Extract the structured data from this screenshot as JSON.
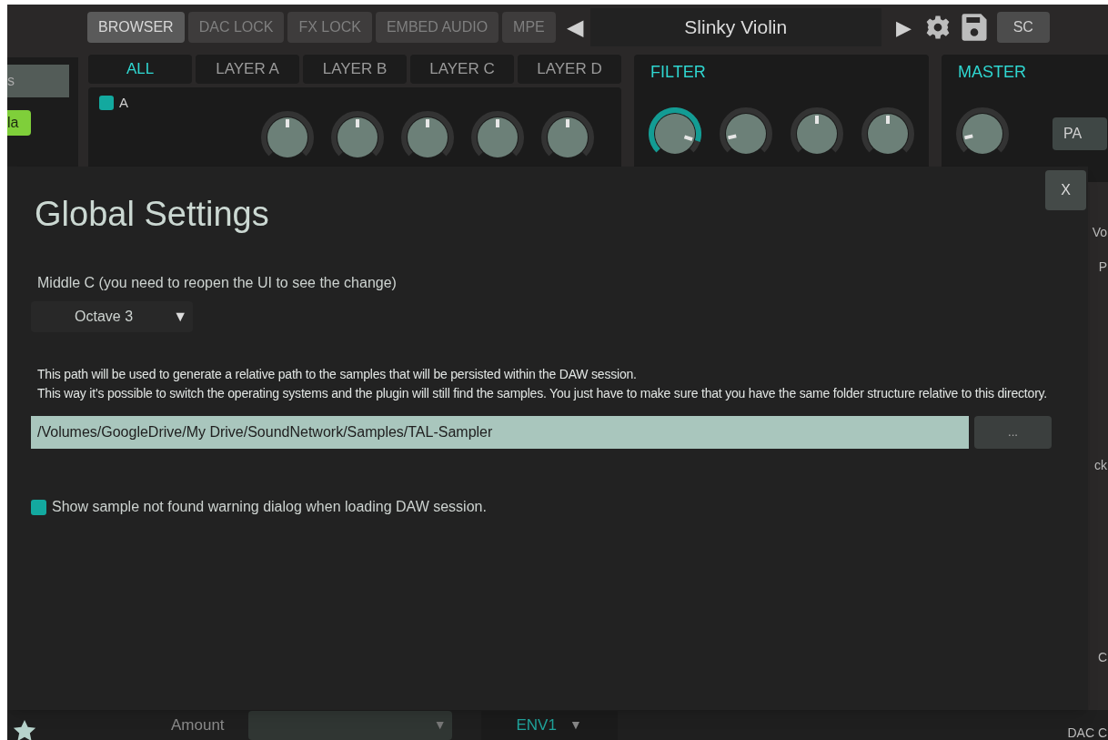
{
  "toolbar": {
    "buttons": [
      {
        "label": "BROWSER",
        "selected": true
      },
      {
        "label": "DAC LOCK",
        "selected": false
      },
      {
        "label": "FX LOCK",
        "selected": false
      },
      {
        "label": "EMBED AUDIO",
        "selected": false
      },
      {
        "label": "MPE",
        "selected": false
      }
    ],
    "prev": "◀",
    "preset": "Slinky Violin",
    "next": "▶",
    "sc": "SC"
  },
  "left_panel": {
    "header": "s",
    "tag": "la"
  },
  "layer_tabs": [
    {
      "label": "ALL",
      "selected": true
    },
    {
      "label": "LAYER A",
      "selected": false
    },
    {
      "label": "LAYER B",
      "selected": false
    },
    {
      "label": "LAYER C",
      "selected": false
    },
    {
      "label": "LAYER D",
      "selected": false
    }
  ],
  "layer": {
    "name": "A",
    "enabled": true,
    "knobs": [
      {
        "highlighted": false
      },
      {
        "highlighted": false
      },
      {
        "highlighted": false
      },
      {
        "highlighted": false
      },
      {
        "highlighted": false
      }
    ]
  },
  "filter": {
    "title": "FILTER",
    "knobs": [
      {
        "highlighted": true
      },
      {
        "highlighted": false
      },
      {
        "highlighted": false
      },
      {
        "highlighted": false
      }
    ]
  },
  "master": {
    "title": "MASTER",
    "knobs": [
      {
        "highlighted": false
      }
    ],
    "button": "PA"
  },
  "right_edge": [
    "Vo",
    "P",
    "ck",
    "C",
    "DAC C"
  ],
  "dialog": {
    "title": "Global Settings",
    "close": "X",
    "middle_c_label": "Middle C (you need to reopen the UI to see the change)",
    "octave": "Octave 3",
    "path_info": [
      "This path will be used to generate a relative path to the samples that will be persisted within the DAW session.",
      "This way it's possible to switch the operating systems and the plugin will still find the samples. You just have to make sure that you have the same folder structure relative to this directory."
    ],
    "path": "/Volumes/GoogleDrive/My Drive/SoundNetwork/Samples/TAL-Sampler",
    "browse": "...",
    "warning": {
      "label": "Show sample not found warning dialog when loading DAW session.",
      "checked": true
    }
  },
  "bottom": {
    "amount": "Amount",
    "source": "ENV1",
    "caret": "▼"
  }
}
